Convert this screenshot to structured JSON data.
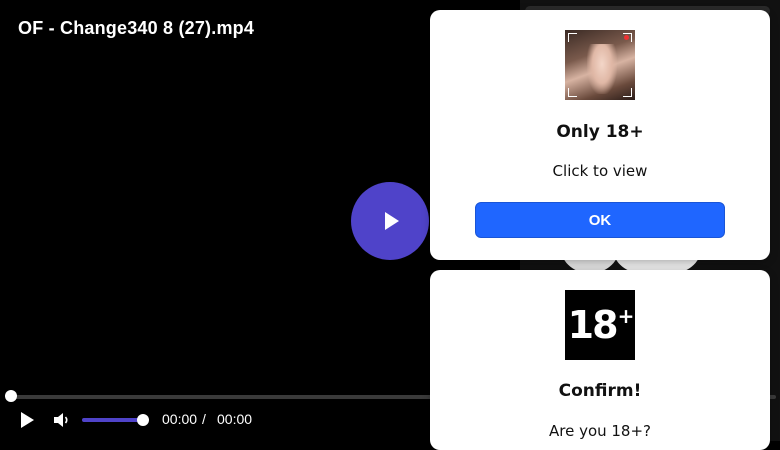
{
  "player": {
    "title": "OF - Change340 8 (27).mp4",
    "current_time": "00:00",
    "time_separator": "/",
    "duration": "00:00",
    "progress_fraction": 0,
    "volume_fraction": 1,
    "accent_color": "#4f43c9"
  },
  "icons": {
    "big_play": "play-icon",
    "play": "play-icon",
    "volume": "volume-icon"
  },
  "popup_view": {
    "title": "Only 18+",
    "message": "Click to view",
    "button_label": "OK",
    "button_color": "#1f66ff"
  },
  "popup_confirm": {
    "badge_number": "18",
    "badge_plus": "+",
    "title": "Confirm!",
    "message": "Are you 18+?"
  }
}
